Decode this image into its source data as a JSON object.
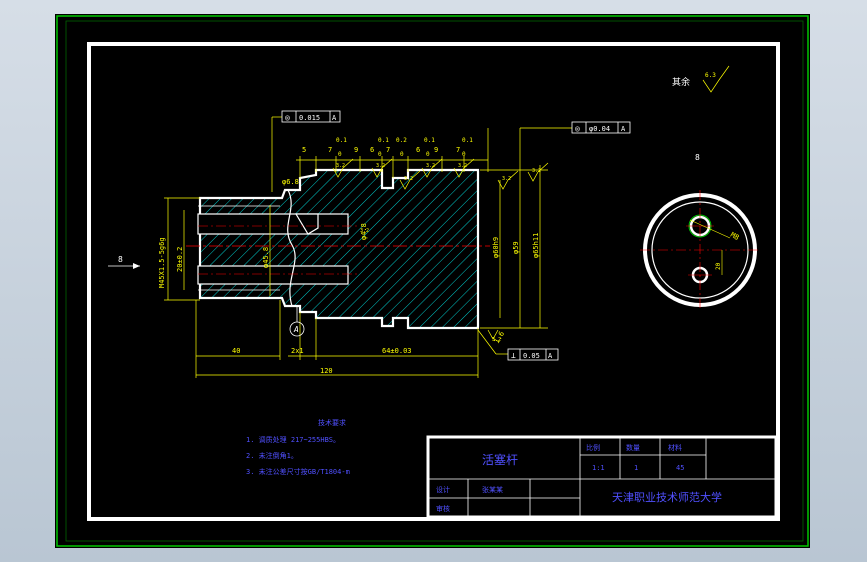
{
  "annotations": {
    "view_label_left": "8",
    "view_label_right": "8",
    "section_mark": "A",
    "roughness_rest_label": "其余",
    "roughness_rest_value": "6.3"
  },
  "gd_t": {
    "top_left": {
      "symbol": "◎",
      "value": "0.015",
      "datum": "A"
    },
    "top_right": {
      "symbol": "◎",
      "value": "φ0.04",
      "datum": "A"
    },
    "bottom": {
      "symbol": "⊥",
      "value": "0.05",
      "datum": "A"
    }
  },
  "dimensions": {
    "top": [
      "5",
      "7",
      "9",
      "6",
      "7",
      "6",
      "9",
      "7"
    ],
    "top_tol_upper": [
      "0.1",
      "0.1",
      "0.2",
      "0.1",
      "0.1"
    ],
    "top_tol_lower": [
      "0",
      "0",
      "0",
      "0",
      "0"
    ],
    "roughness_values": [
      "3.2",
      "3.2",
      "3.2",
      "3.2",
      "3.2",
      "3.2",
      "3.2",
      "3.2",
      "3.2"
    ],
    "small_dia": "φ6.8",
    "thread": "M45X1.5-5g6g",
    "dia_20": "20±0.2",
    "dia_45": "φ45.8",
    "inner_dia": "φ4.8",
    "dia_60": "φ60h9",
    "dia_59": "φ59",
    "dia_65": "φ65h11",
    "chamfer_right": "1.6",
    "bottom_40": "40",
    "bottom_2x1": "2x1",
    "bottom_64": "64±0.03",
    "overall": "120",
    "right_m8": "M8",
    "right_20": "20"
  },
  "tech_requirements": {
    "title": "技术要求",
    "items": [
      "1. 调质处理 217~255HBS。",
      "2. 未注倒角1。",
      "3. 未注公差尺寸按GB/T1804-m"
    ]
  },
  "title_block": {
    "part_name": "活塞杆",
    "headers": [
      "比例",
      "数量",
      "材料"
    ],
    "values": [
      "1:1",
      "1",
      "45"
    ],
    "design_label": "设计",
    "designer_name": "张某某",
    "check_label": "审核",
    "school": "天津职业技术师范大学"
  },
  "colors": {
    "frame": "#ffffff",
    "border": "#00c800",
    "dimension": "#ffff00",
    "outline": "#ffffff",
    "hatch": "#00c8c8",
    "centerline": "#ff0000",
    "title_text": "#4040ff"
  }
}
